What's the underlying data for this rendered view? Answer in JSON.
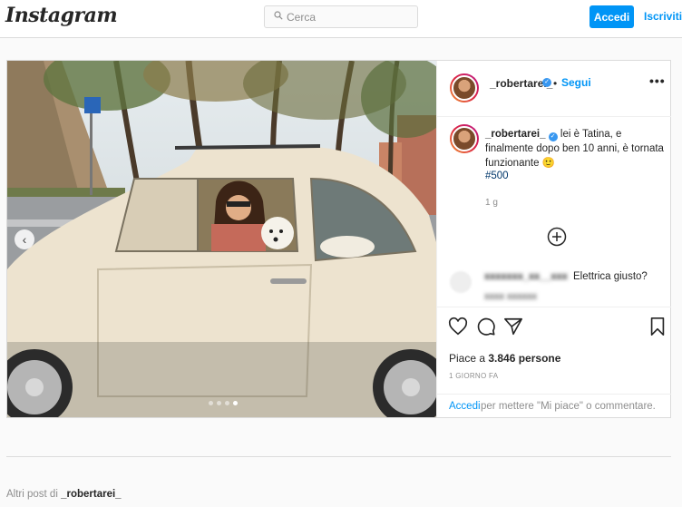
{
  "header": {
    "logo": "Instagram",
    "search_placeholder": "Cerca",
    "login_label": "Accedi",
    "signup_label": "Iscriviti"
  },
  "post": {
    "username": "_robertarei_",
    "follow_label": "Segui",
    "bullet": "•",
    "caption_username": "_robertarei_",
    "caption_text": "lei è Tatina, e finalmente dopo ben 10 anni, è tornata funzionante 🙂",
    "hashtag": "#500",
    "caption_age": "1 g",
    "comment_text": "Elettrica giusto?",
    "likes_prefix": "Piace a ",
    "likes_count": "3.846 persone",
    "time_ago": "1 GIORNO FA",
    "login_link": "Accedi",
    "login_prompt": "per mettere \"Mi piace\" o commentare.",
    "carousel": {
      "slides": 4,
      "active_index": 3
    }
  },
  "footer": {
    "more_posts_prefix": "Altri post di ",
    "more_posts_user": "_robertarei_"
  },
  "colors": {
    "accent": "#0095f6",
    "verified": "#3897f0",
    "car": "#ede3cf"
  },
  "icons": [
    "search-icon",
    "verified-icon",
    "more-options-icon",
    "add-comment-icon",
    "heart-icon",
    "comment-icon",
    "share-icon",
    "bookmark-icon",
    "chevron-left-icon"
  ]
}
